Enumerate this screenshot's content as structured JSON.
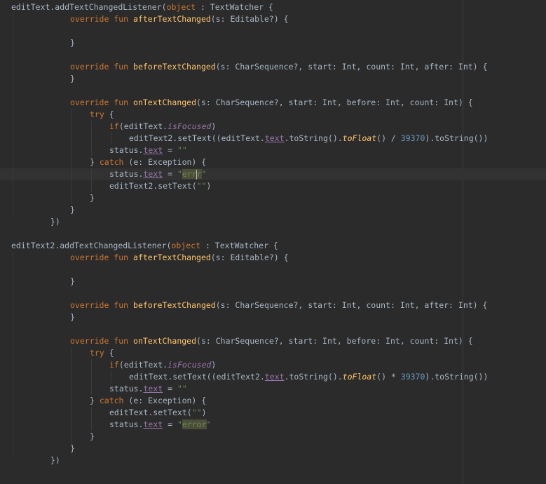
{
  "editor": {
    "lines": [
      {
        "indent": 0,
        "tokens": [
          {
            "t": "editText.addTextChangedListener("
          },
          {
            "t": "object",
            "c": "kw"
          },
          {
            "t": " : TextWatcher {"
          }
        ]
      },
      {
        "indent": 3,
        "tokens": [
          {
            "t": "override fun ",
            "c": "kw"
          },
          {
            "t": "afterTextChanged",
            "c": "fn"
          },
          {
            "t": "(s: Editable?) {"
          }
        ]
      },
      {
        "indent": 0,
        "tokens": []
      },
      {
        "indent": 3,
        "tokens": [
          {
            "t": "}"
          }
        ]
      },
      {
        "indent": 0,
        "tokens": []
      },
      {
        "indent": 3,
        "tokens": [
          {
            "t": "override fun ",
            "c": "kw"
          },
          {
            "t": "beforeTextChanged",
            "c": "fn"
          },
          {
            "t": "(s: CharSequence?, start: Int, count: Int, after: Int) {"
          }
        ]
      },
      {
        "indent": 3,
        "tokens": [
          {
            "t": "}"
          }
        ]
      },
      {
        "indent": 0,
        "tokens": []
      },
      {
        "indent": 3,
        "tokens": [
          {
            "t": "override fun ",
            "c": "kw"
          },
          {
            "t": "onTextChanged",
            "c": "fn"
          },
          {
            "t": "(s: CharSequence?, start: Int, before: Int, count: Int) {"
          }
        ]
      },
      {
        "indent": 4,
        "tokens": [
          {
            "t": "try",
            "c": "kw"
          },
          {
            "t": " {"
          }
        ]
      },
      {
        "indent": 5,
        "tokens": [
          {
            "t": "if",
            "c": "kw"
          },
          {
            "t": "(editText."
          },
          {
            "t": "isFocused",
            "c": "it"
          },
          {
            "t": ")"
          }
        ]
      },
      {
        "indent": 6,
        "tokens": [
          {
            "t": "editText2.setText((editText."
          },
          {
            "t": "text",
            "c": "prop"
          },
          {
            "t": ".toString()."
          },
          {
            "t": "toFloat",
            "c": "ext"
          },
          {
            "t": "() / "
          },
          {
            "t": "39370",
            "c": "num"
          },
          {
            "t": ").toString())"
          }
        ]
      },
      {
        "indent": 5,
        "tokens": [
          {
            "t": "status."
          },
          {
            "t": "text",
            "c": "prop"
          },
          {
            "t": " = "
          },
          {
            "t": "\"\"",
            "c": "str"
          }
        ]
      },
      {
        "indent": 4,
        "tokens": [
          {
            "t": "} "
          },
          {
            "t": "catch",
            "c": "kw"
          },
          {
            "t": " (e: Exception) {"
          }
        ]
      },
      {
        "indent": 5,
        "current": true,
        "tokens": [
          {
            "t": "status."
          },
          {
            "t": "text",
            "c": "prop"
          },
          {
            "t": " = "
          },
          {
            "t": "\"",
            "c": "str"
          },
          {
            "t": "err",
            "c": "str hl"
          },
          {
            "caret": true
          },
          {
            "t": "r",
            "c": "str hl"
          },
          {
            "t": "\"",
            "c": "str"
          }
        ]
      },
      {
        "indent": 5,
        "tokens": [
          {
            "t": "editText2.setText("
          },
          {
            "t": "\"\"",
            "c": "str"
          },
          {
            "t": ")"
          }
        ]
      },
      {
        "indent": 4,
        "tokens": [
          {
            "t": "}"
          }
        ]
      },
      {
        "indent": 3,
        "tokens": [
          {
            "t": "}"
          }
        ]
      },
      {
        "indent": 2,
        "tokens": [
          {
            "t": "})"
          }
        ]
      },
      {
        "indent": 0,
        "tokens": []
      },
      {
        "indent": 0,
        "tokens": [
          {
            "t": "editText2.addTextChangedListener("
          },
          {
            "t": "object",
            "c": "kw"
          },
          {
            "t": " : TextWatcher {"
          }
        ]
      },
      {
        "indent": 3,
        "tokens": [
          {
            "t": "override fun ",
            "c": "kw"
          },
          {
            "t": "afterTextChanged",
            "c": "fn"
          },
          {
            "t": "(s: Editable?) {"
          }
        ]
      },
      {
        "indent": 0,
        "tokens": []
      },
      {
        "indent": 3,
        "tokens": [
          {
            "t": "}"
          }
        ]
      },
      {
        "indent": 0,
        "tokens": []
      },
      {
        "indent": 3,
        "tokens": [
          {
            "t": "override fun ",
            "c": "kw"
          },
          {
            "t": "beforeTextChanged",
            "c": "fn"
          },
          {
            "t": "(s: CharSequence?, start: Int, count: Int, after: Int) {"
          }
        ]
      },
      {
        "indent": 3,
        "tokens": [
          {
            "t": "}"
          }
        ]
      },
      {
        "indent": 0,
        "tokens": []
      },
      {
        "indent": 3,
        "tokens": [
          {
            "t": "override fun ",
            "c": "kw"
          },
          {
            "t": "onTextChanged",
            "c": "fn"
          },
          {
            "t": "(s: CharSequence?, start: Int, before: Int, count: Int) {"
          }
        ]
      },
      {
        "indent": 4,
        "tokens": [
          {
            "t": "try",
            "c": "kw"
          },
          {
            "t": " {"
          }
        ]
      },
      {
        "indent": 5,
        "tokens": [
          {
            "t": "if",
            "c": "kw"
          },
          {
            "t": "(editText."
          },
          {
            "t": "isFocused",
            "c": "it"
          },
          {
            "t": ")"
          }
        ]
      },
      {
        "indent": 6,
        "tokens": [
          {
            "t": "editText.setText((editText2."
          },
          {
            "t": "text",
            "c": "prop"
          },
          {
            "t": ".toString()."
          },
          {
            "t": "toFloat",
            "c": "ext"
          },
          {
            "t": "() * "
          },
          {
            "t": "39370",
            "c": "num"
          },
          {
            "t": ").toString())"
          }
        ]
      },
      {
        "indent": 5,
        "tokens": [
          {
            "t": "status."
          },
          {
            "t": "text",
            "c": "prop"
          },
          {
            "t": " = "
          },
          {
            "t": "\"\"",
            "c": "str"
          }
        ]
      },
      {
        "indent": 4,
        "tokens": [
          {
            "t": "} "
          },
          {
            "t": "catch",
            "c": "kw"
          },
          {
            "t": " (e: Exception) {"
          }
        ]
      },
      {
        "indent": 5,
        "tokens": [
          {
            "t": "editText.setText("
          },
          {
            "t": "\"\"",
            "c": "str"
          },
          {
            "t": ")"
          }
        ]
      },
      {
        "indent": 5,
        "tokens": [
          {
            "t": "status."
          },
          {
            "t": "text",
            "c": "prop"
          },
          {
            "t": " = "
          },
          {
            "t": "\"",
            "c": "str"
          },
          {
            "t": "error",
            "c": "str hl"
          },
          {
            "t": "\"",
            "c": "str"
          }
        ]
      },
      {
        "indent": 4,
        "tokens": [
          {
            "t": "}"
          }
        ]
      },
      {
        "indent": 3,
        "tokens": [
          {
            "t": "}"
          }
        ]
      },
      {
        "indent": 2,
        "tokens": [
          {
            "t": "})"
          }
        ]
      }
    ],
    "colors": {
      "background": "#2b2b2b",
      "text": "#a9b7c6",
      "keyword": "#cc7832",
      "function": "#ffc66d",
      "property": "#9876aa",
      "number": "#6897bb",
      "string": "#6a8759",
      "current_line": "#323232",
      "search_highlight": "#4c4e38"
    }
  }
}
